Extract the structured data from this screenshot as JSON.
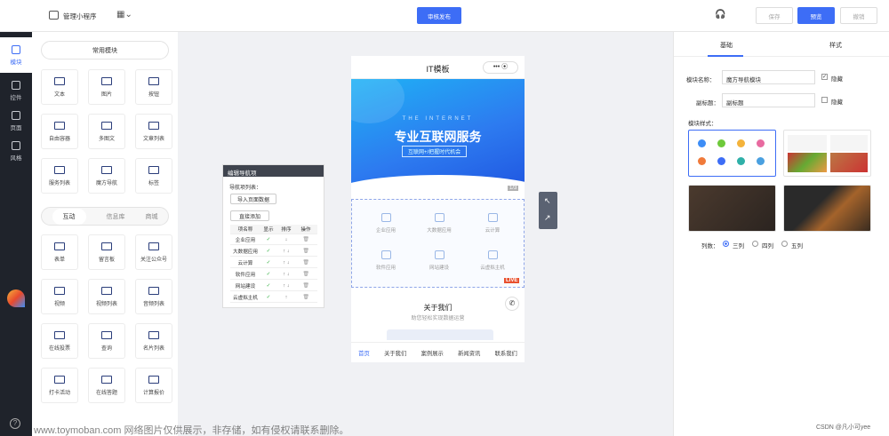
{
  "topbar": {
    "app_name": "管理小程序",
    "publish_button": "审核发布",
    "save_button": "保存",
    "preview_button": "预览",
    "undo_button": "撤销"
  },
  "rail": {
    "items": [
      {
        "label": "模块"
      },
      {
        "label": "控件"
      },
      {
        "label": "页面"
      },
      {
        "label": "风格"
      }
    ]
  },
  "library": {
    "common_header": "常用模块",
    "common": [
      "文本",
      "图片",
      "按钮",
      "自由容器",
      "多图文",
      "文章列表",
      "服务列表",
      "魔方导航",
      "标签"
    ],
    "tabs": [
      "互动",
      "信息库",
      "商城"
    ],
    "interact": [
      "表单",
      "留言板",
      "关注公众号",
      "视频",
      "视频列表",
      "音频列表",
      "在线投票",
      "查询",
      "名片列表",
      "打卡活动",
      "在线答题",
      "计算报价"
    ]
  },
  "phone": {
    "title": "IT模板",
    "banner_small": "THE INTERNET",
    "banner_title": "专业互联网服务",
    "banner_sub": "互联网+/把握时代机会",
    "banner_counter": "1/3",
    "services": [
      "企业应用",
      "大数据应用",
      "云计算",
      "软件应用",
      "网站建设",
      "云虚拟主机"
    ],
    "live_badge": "LIVE",
    "about_title": "关于我们",
    "about_sub": "助您轻松实现数据运营",
    "nav": [
      "首页",
      "关于我们",
      "案例展示",
      "新闻资讯",
      "联系我们"
    ]
  },
  "nav_editor": {
    "title": "编辑导航项",
    "section": "导航项列表：",
    "import_button": "导入页面数据",
    "add_button": "直接添加",
    "headers": [
      "项名称",
      "显示",
      "排序",
      "操作"
    ],
    "rows": [
      {
        "name": "企业应用",
        "show": "✓",
        "sort": "↓",
        "op": "🗑"
      },
      {
        "name": "大数据应用",
        "show": "✓",
        "sort": "↑ ↓",
        "op": "🗑"
      },
      {
        "name": "云计算",
        "show": "✓",
        "sort": "↑ ↓",
        "op": "🗑"
      },
      {
        "name": "软件应用",
        "show": "✓",
        "sort": "↑ ↓",
        "op": "🗑"
      },
      {
        "name": "网站建设",
        "show": "✓",
        "sort": "↑ ↓",
        "op": "🗑"
      },
      {
        "name": "云虚拟主机",
        "show": "✓",
        "sort": "↑",
        "op": "🗑"
      }
    ]
  },
  "right_panel": {
    "tabs": [
      "基础",
      "样式"
    ],
    "name_label": "模块名称：",
    "name_value": "魔方导航模块",
    "subtitle_label": "副标题：",
    "subtitle_value": "副标题",
    "hide_label": "隐藏",
    "style_label": "模块样式：",
    "columns_label": "列数：",
    "columns": [
      "三列",
      "四列",
      "五列"
    ],
    "selected_columns": "三列"
  },
  "watermark": "www.toymoban.com 网络图片仅供展示，非存储，如有侵权请联系删除。",
  "credit": "CSDN @凡小可yee",
  "colors": {
    "accent": "#3d6df6",
    "rail": "#1f232b",
    "check": "#3cb34a",
    "live": "#e8502e"
  }
}
